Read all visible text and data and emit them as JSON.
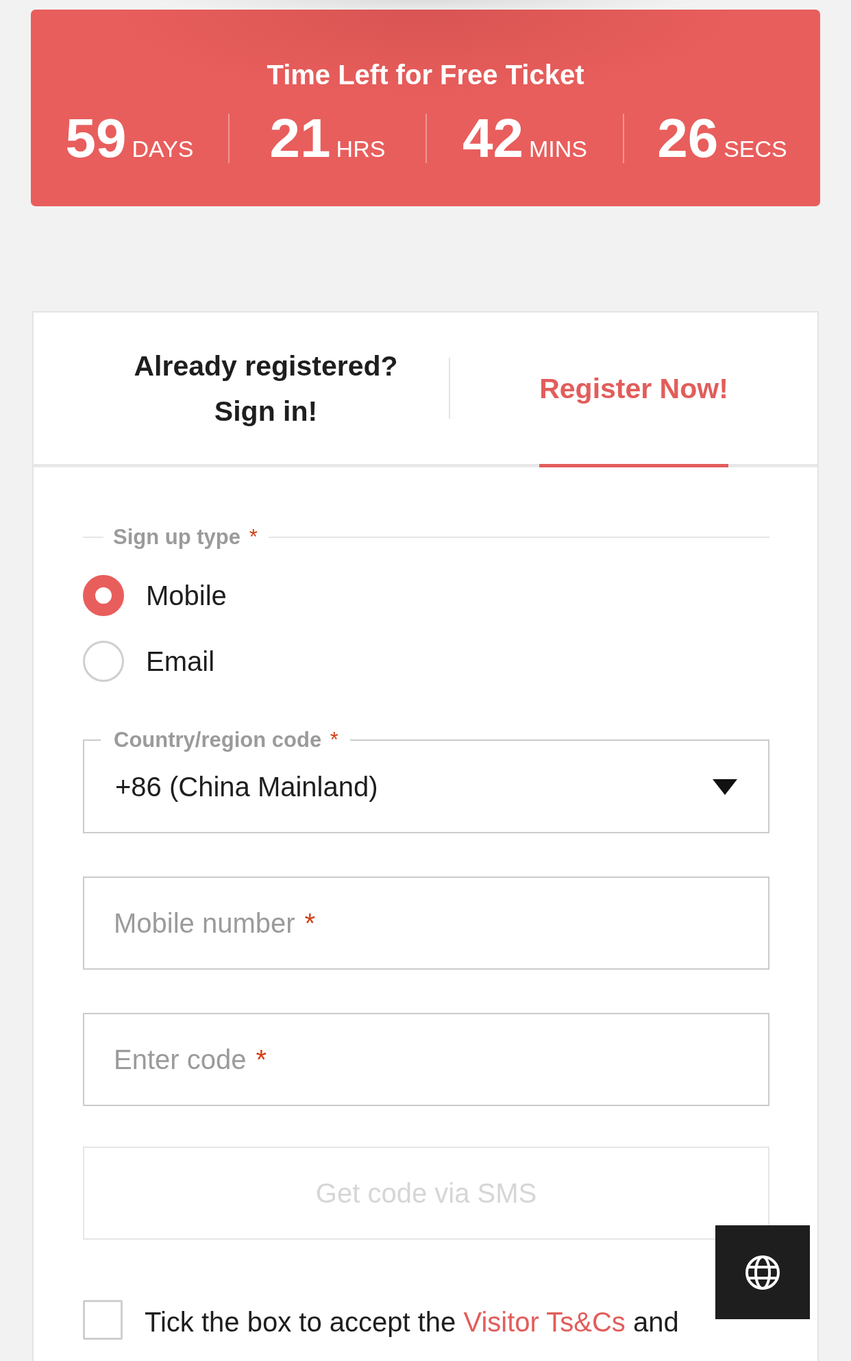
{
  "countdown": {
    "title": "Time Left for Free Ticket",
    "units": [
      {
        "value": "59",
        "unit": "DAYS"
      },
      {
        "value": "21",
        "unit": "HRS"
      },
      {
        "value": "42",
        "unit": "MINS"
      },
      {
        "value": "26",
        "unit": "SECS"
      }
    ]
  },
  "tabs": [
    {
      "label": "Already registered? Sign in!",
      "selected": false
    },
    {
      "label": "Register Now!",
      "selected": true
    }
  ],
  "form": {
    "sign_up_type": {
      "label": "Sign up type",
      "required_mark": "*",
      "options": [
        {
          "label": "Mobile",
          "selected": true
        },
        {
          "label": "Email",
          "selected": false
        }
      ]
    },
    "fields": [
      {
        "kind": "select",
        "label": "Country/region code",
        "required_mark": "*",
        "value": "+86 (China Mainland)"
      },
      {
        "kind": "text",
        "placeholder": "Mobile number",
        "required_mark": "*"
      },
      {
        "kind": "text",
        "placeholder": "Enter code",
        "required_mark": "*"
      }
    ],
    "sms_button": {
      "label": "Get code via SMS",
      "disabled": true
    },
    "terms": {
      "checked": false,
      "parts": [
        {
          "kind": "text",
          "text": "Tick the box to accept the"
        },
        {
          "kind": "link",
          "text": "Visitor Ts&Cs"
        },
        {
          "kind": "text",
          "text": "and"
        }
      ]
    }
  }
}
